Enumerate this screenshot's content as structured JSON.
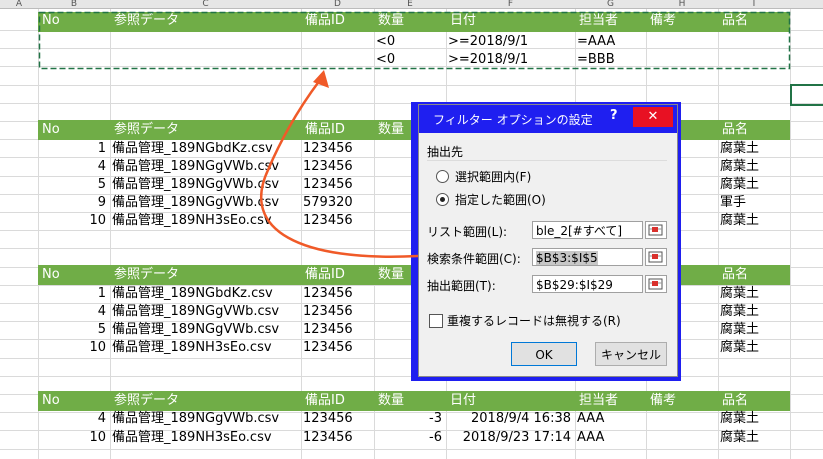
{
  "columns": [
    "A",
    "B",
    "C",
    "D",
    "E",
    "F",
    "G",
    "H",
    "I"
  ],
  "criteria": {
    "headers": [
      "No",
      "参照データ",
      "備品ID",
      "数量",
      "日付",
      "担当者",
      "備考",
      "品名"
    ],
    "rows": [
      [
        "",
        "",
        "",
        "<0",
        ">=2018/9/1",
        "=AAA",
        "",
        ""
      ],
      [
        "",
        "",
        "",
        "<0",
        ">=2018/9/1",
        "=BBB",
        "",
        ""
      ]
    ]
  },
  "table1": {
    "headers": [
      "No",
      "参照データ",
      "備品ID",
      "数量",
      "品名"
    ],
    "rows": [
      [
        "1",
        "備品管理_189NGbdKz.csv",
        "123456",
        "腐葉土"
      ],
      [
        "4",
        "備品管理_189NGgVWb.csv",
        "123456",
        "腐葉土"
      ],
      [
        "5",
        "備品管理_189NGgVWb.csv",
        "123456",
        "腐葉土"
      ],
      [
        "9",
        "備品管理_189NGgVWb.csv",
        "579320",
        "軍手"
      ],
      [
        "10",
        "備品管理_189NH3sEo.csv",
        "123456",
        "腐葉土"
      ]
    ]
  },
  "table2": {
    "headers": [
      "No",
      "参照データ",
      "備品ID",
      "数量",
      "品名"
    ],
    "rows": [
      [
        "1",
        "備品管理_189NGbdKz.csv",
        "123456",
        "腐葉土"
      ],
      [
        "4",
        "備品管理_189NGgVWb.csv",
        "123456",
        "腐葉土"
      ],
      [
        "5",
        "備品管理_189NGgVWb.csv",
        "123456",
        "腐葉土"
      ],
      [
        "10",
        "備品管理_189NH3sEo.csv",
        "123456",
        "腐葉土"
      ]
    ]
  },
  "result": {
    "headers": [
      "No",
      "参照データ",
      "備品ID",
      "数量",
      "日付",
      "担当者",
      "備考",
      "品名"
    ],
    "rows": [
      [
        "4",
        "備品管理_189NGgVWb.csv",
        "123456",
        "-3",
        "2018/9/4 16:38",
        "AAA",
        "",
        "腐葉土"
      ],
      [
        "10",
        "備品管理_189NH3sEo.csv",
        "123456",
        "-6",
        "2018/9/23 17:14",
        "AAA",
        "",
        "腐葉土"
      ]
    ]
  },
  "dialog": {
    "title": "フィルター オプションの設定",
    "help": "?",
    "close": "✕",
    "output_group": "抽出先",
    "radio_inplace": "選択範囲内(F)",
    "radio_copy": "指定した範囲(O)",
    "list_range_label": "リスト範囲(L):",
    "list_range_value": "ble_2[#すべて]",
    "criteria_range_label": "検索条件範囲(C):",
    "criteria_range_value": "$B$3:$I$5",
    "copy_to_label": "抽出範囲(T):",
    "copy_to_value": "$B$29:$I$29",
    "unique_label": "重複するレコードは無視する(R)",
    "ok": "OK",
    "cancel": "キャンセル"
  },
  "colors": {
    "header_green": "#70ad47",
    "dialog_blue": "#1f1ff0",
    "arrow": "#f05a28"
  }
}
